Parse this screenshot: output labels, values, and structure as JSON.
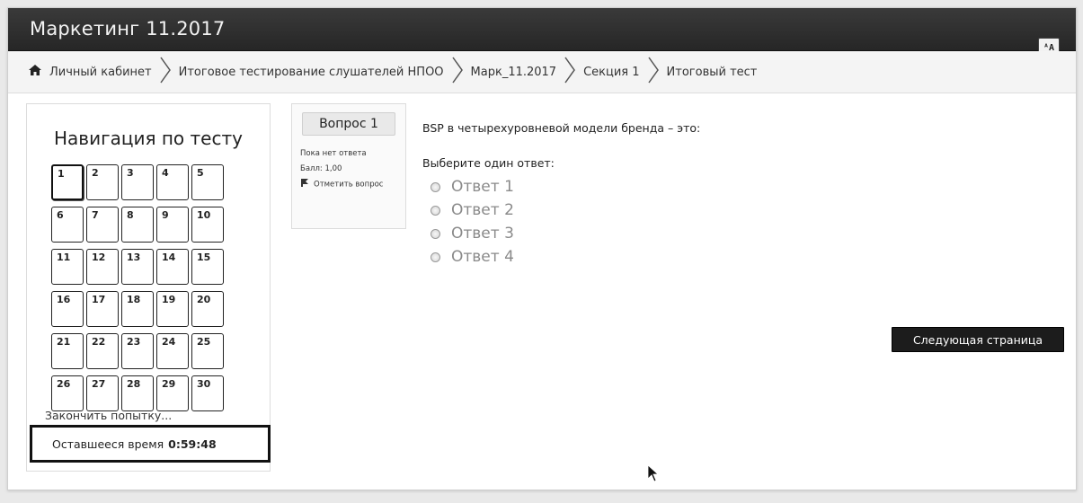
{
  "header": {
    "title": "Маркетинг 11.2017",
    "translate_icon": "translate-icon",
    "translate_glyph": "ᴬA"
  },
  "breadcrumb": {
    "home_icon": "home-icon",
    "separator_icon": "chevron-right-icon",
    "items": [
      "Личный кабинет",
      "Итоговое тестирование слушателей НПОО",
      "Марк_11.2017",
      "Секция 1",
      "Итоговый тест"
    ]
  },
  "quiz_nav": {
    "title": "Навигация по тесту",
    "current_question": 1,
    "questions": [
      "1",
      "2",
      "3",
      "4",
      "5",
      "6",
      "7",
      "8",
      "9",
      "10",
      "11",
      "12",
      "13",
      "14",
      "15",
      "16",
      "17",
      "18",
      "19",
      "20",
      "21",
      "22",
      "23",
      "24",
      "25",
      "26",
      "27",
      "28",
      "29",
      "30"
    ],
    "finish_link": "Закончить попытку...",
    "timer_label": "Оставшееся время",
    "timer_value": "0:59:48"
  },
  "question_info": {
    "label": "Вопрос 1",
    "state": "Пока нет ответа",
    "grade": "Балл: 1,00",
    "flag_label": "Отметить вопрос",
    "flag_icon": "flag-icon"
  },
  "question": {
    "text": "BSP в четырехуровневой модели бренда – это:",
    "prompt": "Выберите один ответ:",
    "answers": [
      "Ответ 1",
      "Ответ 2",
      "Ответ 3",
      "Ответ 4"
    ]
  },
  "actions": {
    "next_label": "Следующая страница"
  },
  "colors": {
    "topbar": "#2c2c2c",
    "next_button": "#1c1c1c",
    "answer_text": "#8a8a8a"
  }
}
